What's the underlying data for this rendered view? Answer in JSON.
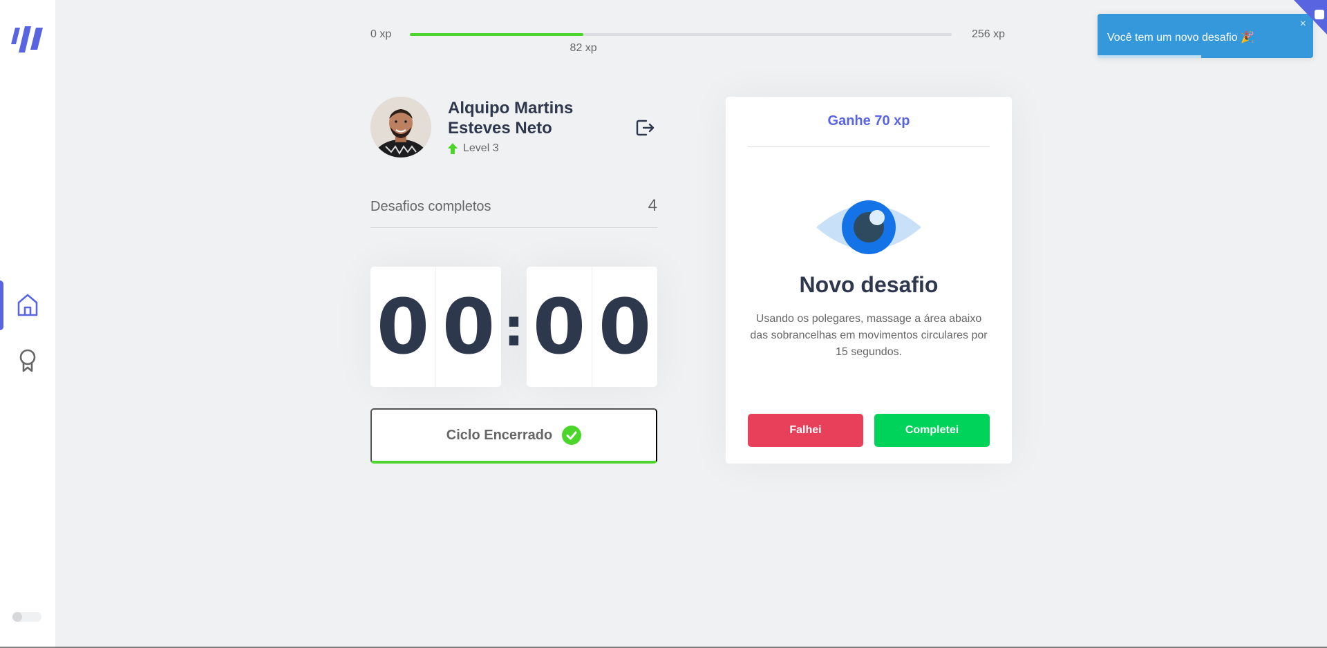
{
  "xp": {
    "min_label": "0 xp",
    "max_label": "256 xp",
    "current_label": "82 xp",
    "current": 82,
    "max": 256
  },
  "profile": {
    "name": "Alquipo Martins Esteves Neto",
    "level_label": "Level 3"
  },
  "completed": {
    "label": "Desafios completos",
    "count": "4"
  },
  "countdown": {
    "minute_tens": "0",
    "minute_ones": "0",
    "separator": ":",
    "second_tens": "0",
    "second_ones": "0"
  },
  "cycle_button": {
    "label": "Ciclo Encerrado"
  },
  "challenge": {
    "reward": "Ganhe 70 xp",
    "title": "Novo desafio",
    "description": "Usando os polegares, massage a área abaixo das sobrancelhas em movimentos circulares por 15 segundos.",
    "fail_label": "Falhei",
    "success_label": "Completei",
    "icon": "eye-icon"
  },
  "toast": {
    "message": "Você tem um novo desafio 🎉",
    "close_symbol": "×",
    "progress": 0.48
  },
  "sidebar": {
    "items": [
      {
        "icon": "home-icon",
        "active": true
      },
      {
        "icon": "award-icon",
        "active": false
      }
    ],
    "theme_toggle_on": false
  },
  "colors": {
    "accent": "#5965e0",
    "success": "#4cd62b",
    "fail": "#e83f5b",
    "toast": "#3498db",
    "background": "#f0f1f3"
  }
}
